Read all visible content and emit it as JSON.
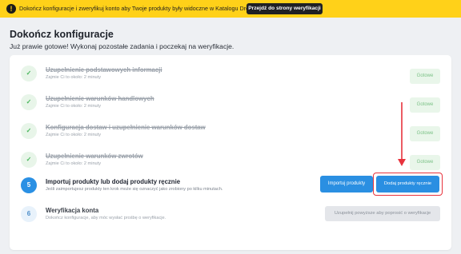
{
  "banner": {
    "icon": "warning-icon",
    "text": "Dokończ konfiguracje i zweryfikuj konto aby Twoje produkty były widoczne w Katalogu Droplo.",
    "button_label": "Przejdź do strony weryfikacji"
  },
  "page": {
    "title": "Dokończ konfiguracje",
    "subtitle": "Już prawie gotowe! Wykonaj pozostałe zadania i poczekaj na weryfikacje."
  },
  "steps": [
    {
      "status": "done",
      "icon": "check-icon",
      "number": "✓",
      "title": "Uzupełnienie podstawowych informacji",
      "subtitle": "Zajmie Ci to około: 2 minuty",
      "action": "Gotowe"
    },
    {
      "status": "done",
      "icon": "check-icon",
      "number": "✓",
      "title": "Uzupełnienie warunków handlowych",
      "subtitle": "Zajmie Ci to około: 2 minuty",
      "action": "Gotowe"
    },
    {
      "status": "done",
      "icon": "check-icon",
      "number": "✓",
      "title": "Konfiguracja dostaw i uzupełnienie warunków dostaw",
      "subtitle": "Zajmie Ci to około: 2 minuty",
      "action": "Gotowe"
    },
    {
      "status": "done",
      "icon": "check-icon",
      "number": "✓",
      "title": "Uzupełnienie warunków zwrotów",
      "subtitle": "Zajmie Ci to około: 2 minuty",
      "action": "Gotowe"
    },
    {
      "status": "active",
      "number": "5",
      "title": "Importuj produkty lub dodaj produkty ręcznie",
      "subtitle": "Jeśli zaimportujesz produkty ten krok może się oznaczyć jako zrobiony po kilku minutach.",
      "action_primary": "Importuj produkty",
      "action_secondary": "Dodaj produkty ręcznie"
    },
    {
      "status": "pending",
      "number": "6",
      "title": "Weryfikacja konta",
      "subtitle": "Dokończ konfiguracje, aby móc wysłać prośbę o weryfikacje.",
      "action": "Uzupełnij powyższe aby poprosić o weryfikacje"
    }
  ],
  "colors": {
    "banner_bg": "#ffd119",
    "accent": "#2a8fe2",
    "success": "#47b65a",
    "highlight": "#e8333d"
  }
}
